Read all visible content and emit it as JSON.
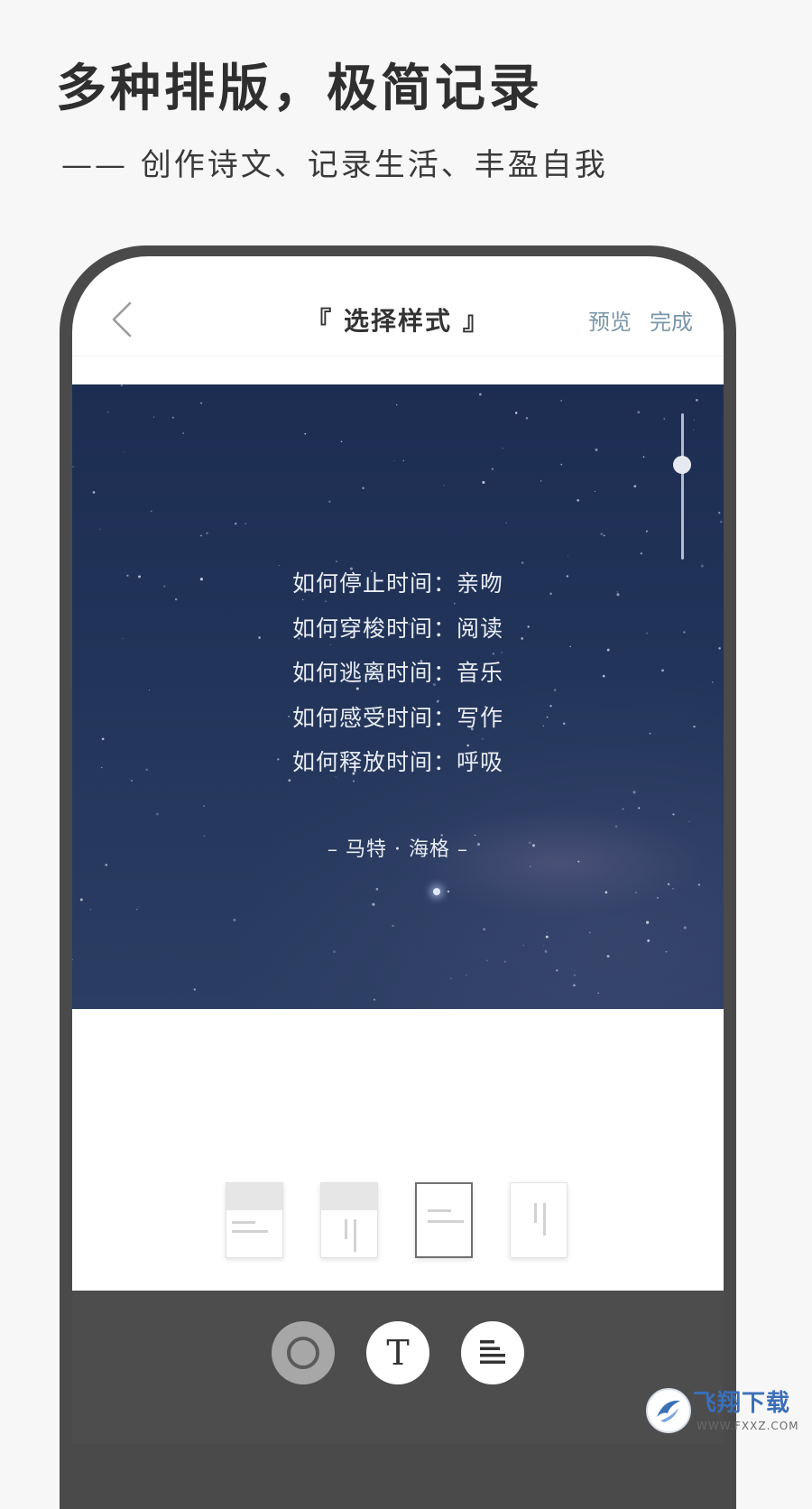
{
  "promo": {
    "headline": "多种排版，极简记录",
    "subline": "—— 创作诗文、记录生活、丰盈自我"
  },
  "nav": {
    "back_icon": "chevron-left-icon",
    "title": "『 选择样式 』",
    "preview_label": "预览",
    "done_label": "完成",
    "action_color": "#7a96aa"
  },
  "poster": {
    "background": "starry-night-sky",
    "lines": [
      "如何停止时间：亲吻",
      "如何穿梭时间：阅读",
      "如何逃离时间：音乐",
      "如何感受时间：写作",
      "如何释放时间：呼吸"
    ],
    "author": "– 马特 · 海格 –",
    "slider_level": 0.35
  },
  "layout_options": [
    {
      "id": "image-top-horizontal-text",
      "icon": "layout-image-top-horizontal-icon",
      "selected": false
    },
    {
      "id": "image-top-vertical-text",
      "icon": "layout-image-top-vertical-icon",
      "selected": false
    },
    {
      "id": "text-only-horizontal",
      "icon": "layout-text-horizontal-icon",
      "selected": true
    },
    {
      "id": "text-only-vertical",
      "icon": "layout-text-vertical-icon",
      "selected": false
    }
  ],
  "toolbar": {
    "tools": [
      {
        "id": "background-tool",
        "icon": "circle-icon",
        "active": true
      },
      {
        "id": "font-tool",
        "icon": "text-t-icon",
        "glyph": "T",
        "active": false
      },
      {
        "id": "align-tool",
        "icon": "align-left-icon",
        "active": false
      }
    ]
  },
  "watermark": {
    "text": "飞翔下载",
    "domain": "WWW.FXXZ.COM"
  }
}
